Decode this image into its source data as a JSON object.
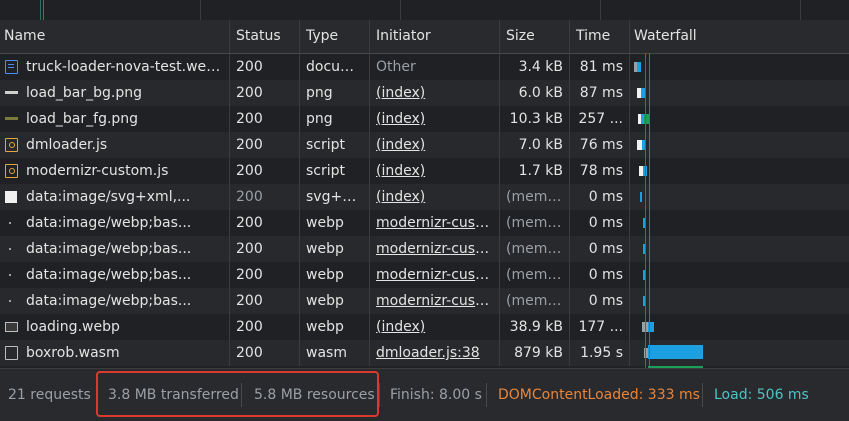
{
  "columns": {
    "name": "Name",
    "status": "Status",
    "type": "Type",
    "initiator": "Initiator",
    "size": "Size",
    "time": "Time",
    "waterfall": "Waterfall"
  },
  "rows": [
    {
      "name": "truck-loader-nova-test.web...",
      "status": "200",
      "type": "docum...",
      "initiator": "Other",
      "size": "3.4 kB",
      "time": "81 ms",
      "icon": "document-icon"
    },
    {
      "name": "load_bar_bg.png",
      "status": "200",
      "type": "png",
      "initiator": "(index)",
      "size": "6.0 kB",
      "time": "87 ms",
      "icon": "image-bar-icon"
    },
    {
      "name": "load_bar_fg.png",
      "status": "200",
      "type": "png",
      "initiator": "(index)",
      "size": "10.3 kB",
      "time": "257 ...",
      "icon": "image-bar-icon"
    },
    {
      "name": "dmloader.js",
      "status": "200",
      "type": "script",
      "initiator": "(index)",
      "size": "7.0 kB",
      "time": "76 ms",
      "icon": "script-icon"
    },
    {
      "name": "modernizr-custom.js",
      "status": "200",
      "type": "script",
      "initiator": "(index)",
      "size": "1.7 kB",
      "time": "78 ms",
      "icon": "script-icon"
    },
    {
      "name": "data:image/svg+xml,...",
      "status": "200",
      "type": "svg+xml",
      "initiator": "(index)",
      "size": "(memo...",
      "time": "0 ms",
      "icon": "svg-image-icon"
    },
    {
      "name": "data:image/webp;bas...",
      "status": "200",
      "type": "webp",
      "initiator": "modernizr-cust...",
      "size": "(memo...",
      "time": "0 ms",
      "icon": "webp-image-icon"
    },
    {
      "name": "data:image/webp;bas...",
      "status": "200",
      "type": "webp",
      "initiator": "modernizr-cust...",
      "size": "(memo...",
      "time": "0 ms",
      "icon": "webp-image-icon"
    },
    {
      "name": "data:image/webp;bas...",
      "status": "200",
      "type": "webp",
      "initiator": "modernizr-cust...",
      "size": "(memo...",
      "time": "0 ms",
      "icon": "webp-image-icon"
    },
    {
      "name": "data:image/webp;bas...",
      "status": "200",
      "type": "webp",
      "initiator": "modernizr-cust...",
      "size": "(memo...",
      "time": "0 ms",
      "icon": "webp-image-icon"
    },
    {
      "name": "loading.webp",
      "status": "200",
      "type": "webp",
      "initiator": "(index)",
      "size": "38.9 kB",
      "time": "177 ...",
      "icon": "image-icon"
    },
    {
      "name": "boxrob.wasm",
      "status": "200",
      "type": "wasm",
      "initiator": "dmloader.js:38",
      "size": "879 kB",
      "time": "1.95 s",
      "icon": "file-icon"
    }
  ],
  "footer": {
    "requests": "21 requests",
    "transferred": "3.8 MB transferred",
    "resources": "5.8 MB resources",
    "finish": "Finish: 8.00 s",
    "dom_content_loaded": "DOMContentLoaded: 333 ms",
    "load": "Load: 506 ms"
  },
  "colors": {
    "dom_content_loaded": "#e9853a",
    "load": "#4ec3c4",
    "highlight": "#d93a2b",
    "waiting": "#1ba1e2",
    "receiving": "#1aa058"
  }
}
